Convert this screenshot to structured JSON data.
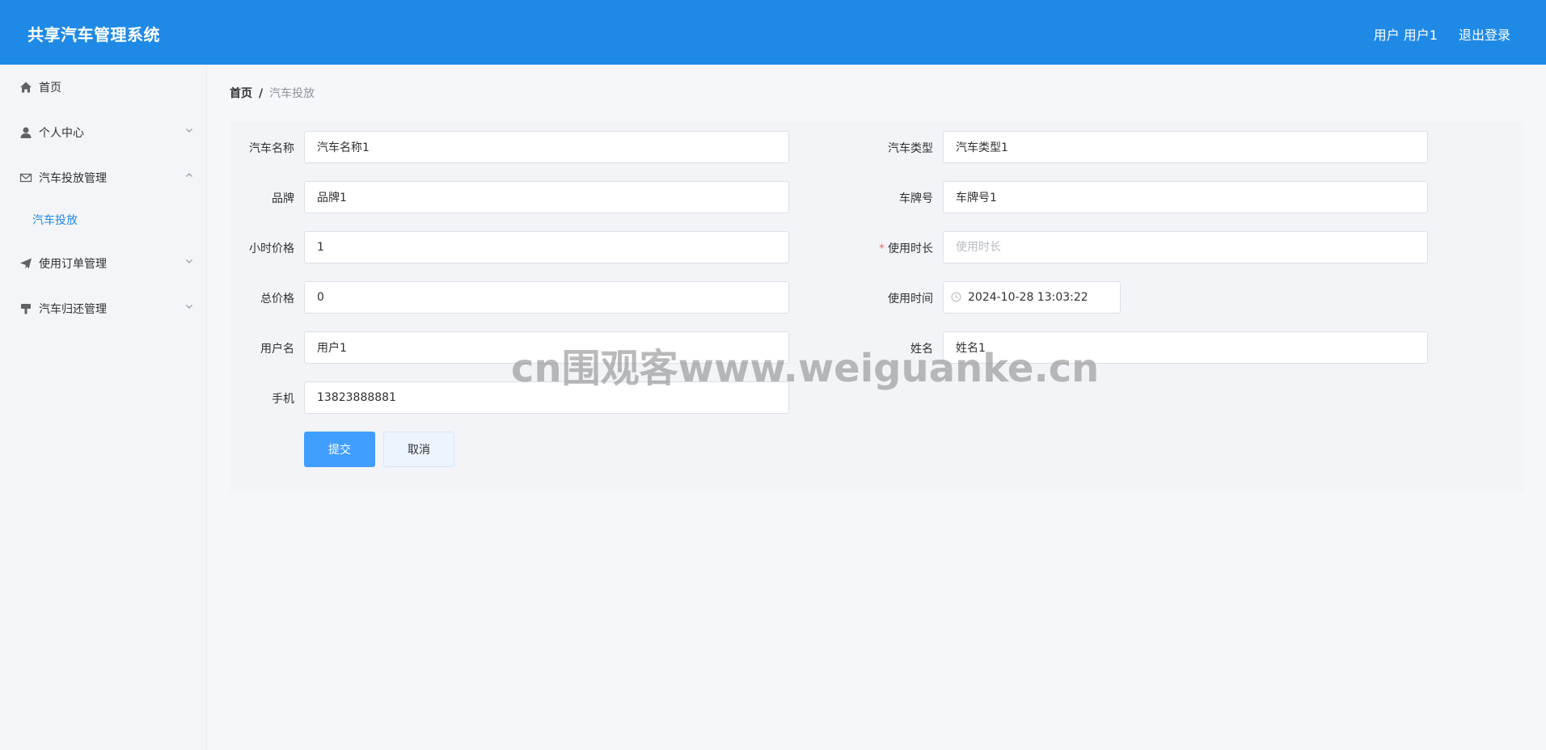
{
  "header": {
    "title": "共享汽车管理系统",
    "user_text": "用户 用户1",
    "logout_label": "退出登录"
  },
  "sidebar": {
    "items": [
      {
        "label": "首页",
        "icon": "home-icon"
      },
      {
        "label": "个人中心",
        "icon": "user-icon"
      },
      {
        "label": "汽车投放管理",
        "icon": "mail-icon"
      },
      {
        "label": "使用订单管理",
        "icon": "send-icon"
      },
      {
        "label": "汽车归还管理",
        "icon": "brush-icon"
      }
    ],
    "subitems": [
      {
        "label": "汽车投放"
      }
    ]
  },
  "breadcrumb": {
    "home": "首页",
    "separator": "/",
    "current": "汽车投放"
  },
  "form": {
    "car_name": {
      "label": "汽车名称",
      "value": "汽车名称1"
    },
    "car_type": {
      "label": "汽车类型",
      "value": "汽车类型1"
    },
    "brand": {
      "label": "品牌",
      "value": "品牌1"
    },
    "plate": {
      "label": "车牌号",
      "value": "车牌号1"
    },
    "hour_price": {
      "label": "小时价格",
      "value": "1"
    },
    "duration": {
      "label": "使用时长",
      "value": "",
      "placeholder": "使用时长",
      "required_mark": "*"
    },
    "total_price": {
      "label": "总价格",
      "value": "0"
    },
    "use_time": {
      "label": "使用时间",
      "value": "2024-10-28 13:03:22"
    },
    "username": {
      "label": "用户名",
      "value": "用户1"
    },
    "realname": {
      "label": "姓名",
      "value": "姓名1"
    },
    "phone": {
      "label": "手机",
      "value": "13823888881"
    }
  },
  "buttons": {
    "submit": "提交",
    "cancel": "取消"
  },
  "watermark": "cn围观客www.weiguanke.cn",
  "colors": {
    "header_bg": "#1f8ae6",
    "accent": "#409eff",
    "active_menu": "#1f8ae6",
    "required": "#f56c6c"
  }
}
